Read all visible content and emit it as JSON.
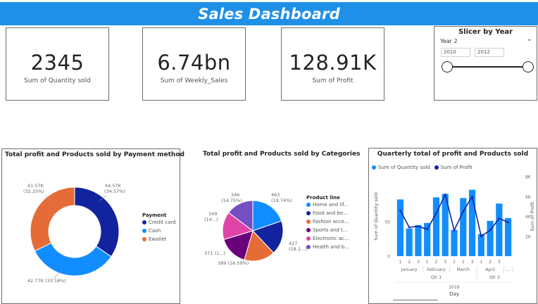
{
  "header": {
    "title": "Sales Dashboard"
  },
  "kpis": [
    {
      "value": "2345",
      "label": "Sum of Quantity sold"
    },
    {
      "value": "6.74bn",
      "label": "Sum of Weekly_Sales"
    },
    {
      "value": "128.91K",
      "label": "Sum of Profit"
    }
  ],
  "slicer": {
    "title": "Slicer by Year",
    "dropdown_label": "Year 2",
    "from": "2010",
    "to": "2012"
  },
  "donut": {
    "title": "Total profit and Products sold by Payment method",
    "legend_title": "Payment",
    "labels": [
      {
        "value": "41.57K",
        "pct": "(32.25%)"
      },
      {
        "value": "44.57K",
        "pct": "(34.57%)"
      },
      {
        "value": "42.77K",
        "pct": "(33.18%)"
      }
    ],
    "colors": {
      "credit": "#12239e",
      "cash": "#118dff",
      "ewallet": "#e66c37"
    }
  },
  "pie": {
    "title": "Total profit and Products sold by Categories",
    "legend_title": "Product line",
    "labels": [
      "463",
      "(19.74%)",
      "427",
      "(18.2...)",
      "389 (16.59%)",
      "371 (1...)",
      "349",
      "(14...)",
      "346",
      "(14.75%)"
    ],
    "colors": [
      "#118dff",
      "#12239e",
      "#e66c37",
      "#6b007b",
      "#e044a7",
      "#744ec2"
    ]
  },
  "combo": {
    "title": "Quarterly total of profit and Products sold",
    "y_left_label": "Sum of Quantity sold",
    "y_right_label": "Sum of Profit",
    "x_label": "Day",
    "year_label": "2019",
    "y_left_ticks": [
      "0",
      "50"
    ],
    "y_right_ticks": [
      "2K",
      "4K",
      "6K",
      "8K"
    ],
    "colors": {
      "bar": "#118dff",
      "line": "#12239e"
    }
  },
  "chart_data": [
    {
      "type": "pie",
      "variant": "donut",
      "title": "Total profit and Products sold by Payment method",
      "legend_title": "Payment",
      "categories": [
        "Credit card",
        "Cash",
        "Ewallet"
      ],
      "values": [
        44570,
        42770,
        41570
      ],
      "value_labels": [
        "44.57K (34.57%)",
        "42.77K (33.18%)",
        "41.57K (32.25%)"
      ],
      "legend_position": "right"
    },
    {
      "type": "pie",
      "title": "Total profit and Products sold by Categories",
      "legend_title": "Product line",
      "categories": [
        "Home and lif...",
        "Food and be...",
        "Fashion acce...",
        "Sports and t...",
        "Electronic ac...",
        "Health and b..."
      ],
      "values": [
        463,
        427,
        389,
        371,
        349,
        346
      ],
      "legend_position": "right"
    },
    {
      "type": "bar",
      "title": "Quarterly total of profit and Products sold",
      "categories": [
        "1",
        "2",
        "3",
        "1",
        "2",
        "3",
        "1",
        "2",
        "3",
        "1",
        "2",
        "3"
      ],
      "month_groups": [
        "January",
        "February",
        "March",
        "April",
        "..."
      ],
      "quarter_groups": [
        "Qtr 1",
        "Qtr 2"
      ],
      "xlabel": "Day",
      "ylabel": "Sum of Quantity sold",
      "y2label": "Sum of Profit",
      "ylim": [
        0,
        115
      ],
      "y2lim": [
        0,
        8000
      ],
      "legend_position": "top-left",
      "series": [
        {
          "name": "Sum of Quantity sold",
          "kind": "bar",
          "values": [
            82,
            40,
            45,
            48,
            85,
            90,
            38,
            84,
            96,
            32,
            51,
            76,
            55
          ]
        },
        {
          "name": "Sum of Profit",
          "kind": "line",
          "axis": "right",
          "values": [
            4600,
            2900,
            3000,
            2700,
            4300,
            6200,
            2600,
            4500,
            6000,
            2000,
            2600,
            3800,
            3400
          ]
        }
      ]
    }
  ]
}
